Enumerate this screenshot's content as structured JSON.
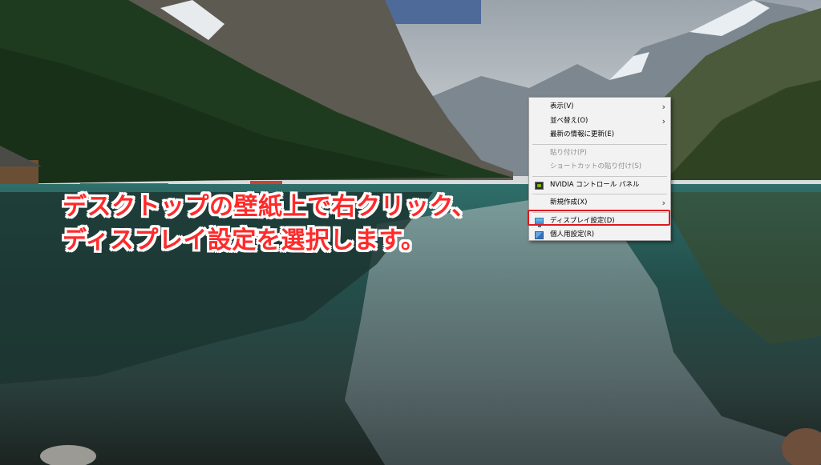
{
  "caption": {
    "line1": "デスクトップの壁紙上で右クリック、",
    "line2": "ディスプレイ設定を選択します。"
  },
  "context_menu": {
    "items": [
      {
        "label": "表示(V)",
        "submenu": true,
        "disabled": false
      },
      {
        "label": "並べ替え(O)",
        "submenu": true,
        "disabled": false
      },
      {
        "label": "最新の情報に更新(E)",
        "submenu": false,
        "disabled": false
      },
      {
        "label": "貼り付け(P)",
        "submenu": false,
        "disabled": true
      },
      {
        "label": "ショートカットの貼り付け(S)",
        "submenu": false,
        "disabled": true
      },
      {
        "label": "NVIDIA コントロール パネル",
        "icon": "nvidia-icon"
      },
      {
        "label": "新規作成(X)",
        "submenu": true,
        "disabled": false
      },
      {
        "label": "ディスプレイ設定(D)",
        "icon": "display-settings-icon",
        "highlighted": true
      },
      {
        "label": "個人用設定(R)",
        "icon": "personalize-icon"
      }
    ],
    "submenu_arrow": "›"
  },
  "colors": {
    "caption_text": "#ff2a2a",
    "caption_outline": "#ffffff",
    "highlight_border": "#e0181f",
    "menu_bg": "#f2f2f2"
  }
}
